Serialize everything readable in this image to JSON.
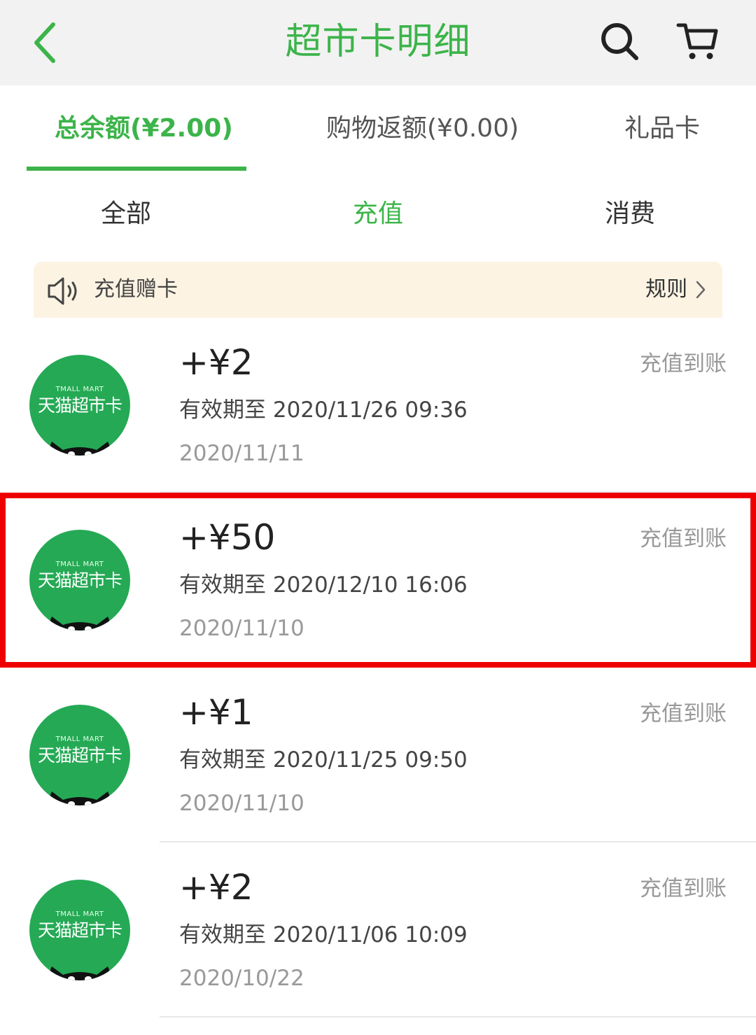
{
  "header": {
    "title": "超市卡明细",
    "back_icon": "chevron-left-icon",
    "search_icon": "search-icon",
    "cart_icon": "cart-icon",
    "accent_color": "#3cb44a"
  },
  "balance_tabs": [
    {
      "label": "总余额(¥2.00)",
      "active": true
    },
    {
      "label": "购物返额(¥0.00)",
      "active": false
    },
    {
      "label": "礼品卡",
      "active": false
    }
  ],
  "filter_tabs": [
    {
      "label": "全部",
      "active": false
    },
    {
      "label": "充值",
      "active": true
    },
    {
      "label": "消费",
      "active": false
    }
  ],
  "notice": {
    "icon": "speaker-icon",
    "text": "充值赠卡",
    "rule_label": "规则",
    "rule_icon": "chevron-right-icon",
    "background_color": "#fcf3e3"
  },
  "card_logo": {
    "english": "TMALL MART",
    "chinese": "天猫超市卡",
    "color": "#25a955"
  },
  "records": [
    {
      "amount": "+¥2",
      "expiry": "有效期至 2020/11/26 09:36",
      "date": "2020/11/11",
      "status": "充值到账",
      "highlighted": false
    },
    {
      "amount": "+¥50",
      "expiry": "有效期至 2020/12/10 16:06",
      "date": "2020/11/10",
      "status": "充值到账",
      "highlighted": true
    },
    {
      "amount": "+¥1",
      "expiry": "有效期至 2020/11/25 09:50",
      "date": "2020/11/10",
      "status": "充值到账",
      "highlighted": false
    },
    {
      "amount": "+¥2",
      "expiry": "有效期至 2020/11/06 10:09",
      "date": "2020/10/22",
      "status": "充值到账",
      "highlighted": false
    }
  ]
}
